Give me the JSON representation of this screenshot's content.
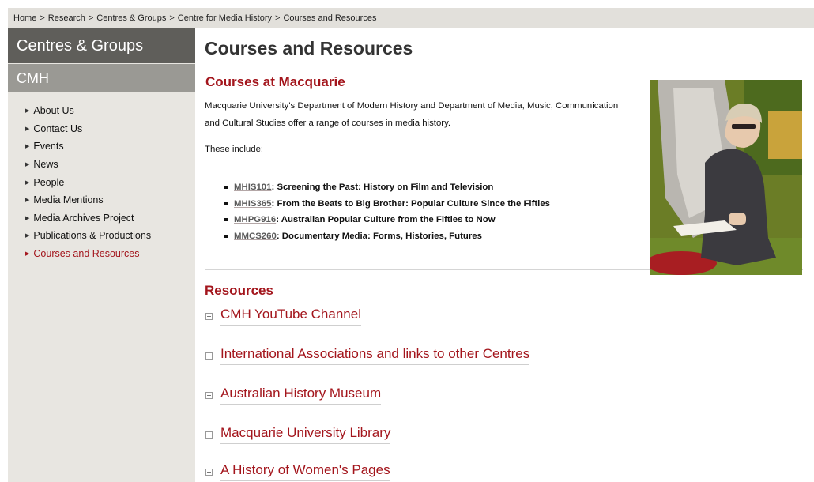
{
  "breadcrumb": {
    "items": [
      "Home",
      "Research",
      "Centres & Groups",
      "Centre for Media History",
      "Courses and Resources"
    ],
    "separator": ">"
  },
  "sidebar": {
    "group_heading": "Centres & Groups",
    "sub_heading": "CMH",
    "items": [
      {
        "label": "About Us"
      },
      {
        "label": "Contact Us"
      },
      {
        "label": "Events"
      },
      {
        "label": "News"
      },
      {
        "label": "People"
      },
      {
        "label": "Media Mentions"
      },
      {
        "label": "Media Archives Project"
      },
      {
        "label": "Publications & Productions"
      },
      {
        "label": "Courses and Resources",
        "active": true
      }
    ]
  },
  "main": {
    "title": "Courses and Resources",
    "courses": {
      "heading": "Courses at Macquarie",
      "intro": "Macquarie University's Department of Modern History and Department of Media, Music, Communication and Cultural Studies offer a range of courses in media history.",
      "includes_label": "These include:",
      "list": [
        {
          "code": "MHIS101",
          "title": ": Screening the Past: History on Film and Television"
        },
        {
          "code": "MHIS365",
          "title": ": From the Beats to Big Brother: Popular Culture Since the Fifties"
        },
        {
          "code": "MHPG916",
          "title": ": Australian Popular Culture from the Fifties to Now"
        },
        {
          "code": "MMCS260",
          "title": ": Documentary Media: Forms, Histories, Futures"
        }
      ]
    },
    "resources": {
      "heading": "Resources",
      "items": [
        {
          "label": "CMH YouTube Channel"
        },
        {
          "label": "International Associations and links to other Centres"
        },
        {
          "label": "Australian History Museum"
        },
        {
          "label": "Macquarie University Library"
        },
        {
          "label": "A History of Women's Pages"
        }
      ]
    }
  },
  "colors": {
    "accent": "#a3151c",
    "sidebar_dark": "#5f5e5a",
    "sidebar_mid": "#9a9994",
    "sidebar_bg": "#e8e6e1",
    "breadcrumb_bg": "#e2e0db"
  }
}
